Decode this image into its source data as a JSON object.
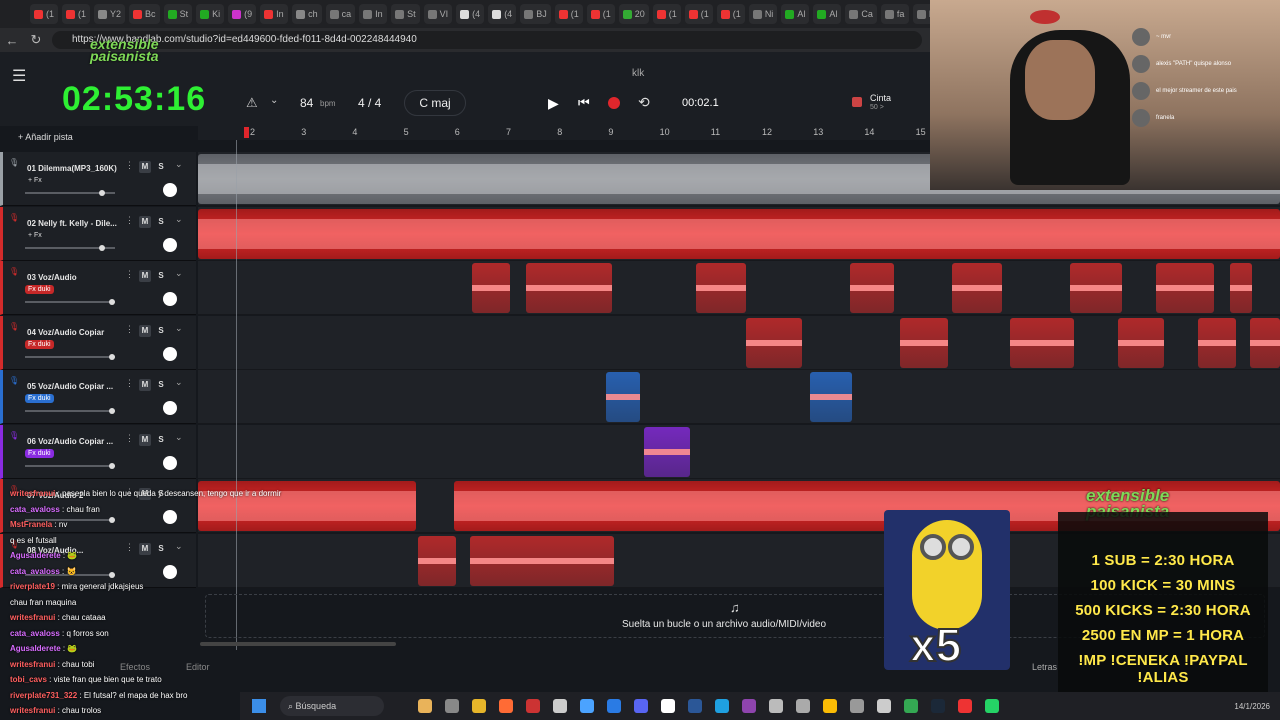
{
  "browser": {
    "tabs": [
      "(1",
      "(1",
      "Y2",
      "Bc",
      "St",
      "Ki",
      "(9",
      "In",
      "ch",
      "ca",
      "In",
      "St",
      "VI",
      "(4",
      "(4",
      "BJ",
      "(1",
      "(1",
      "20",
      "(1",
      "(1",
      "(1",
      "Ni",
      "Al",
      "Al",
      "Ca",
      "fa",
      "Di"
    ],
    "url": "https://www.bandlab.com/studio?id=ed449600-fded-f011-8d4d-002248444940"
  },
  "overlay": {
    "timer": "02:53:16",
    "logo_line1": "extensible",
    "logo_line2": "paisanista"
  },
  "daw": {
    "project_title": "klk",
    "bpm": "84",
    "bpm_unit": "bpm",
    "time_signature": "4 / 4",
    "key": "C maj",
    "time_display": "00:02.1",
    "cinta_label": "Cinta",
    "cinta_sub": "50 >",
    "add_track": "+ Añadir pista",
    "ruler_marks": [
      "2",
      "3",
      "4",
      "5",
      "6",
      "7",
      "8",
      "9",
      "10",
      "11",
      "12",
      "13",
      "14",
      "15"
    ],
    "drop_hint": "Suelta un bucle o un archivo audio/MIDI/video",
    "bottom_tabs": [
      "Efectos",
      "Editor"
    ],
    "letras": "Letras",
    "tracks": [
      {
        "number": "01",
        "name": "Dilemma(MP3_160K)",
        "fx": "+ Fx",
        "fx_color": "none",
        "color": "#9aa0a6",
        "mute": "M",
        "solo": "S"
      },
      {
        "number": "02",
        "name": "Nelly ft. Kelly - Dile...",
        "fx": "+ Fx",
        "fx_color": "none",
        "color": "#d32b2b",
        "mute": "M",
        "solo": "S"
      },
      {
        "number": "03",
        "name": "Voz/Audio",
        "fx": "Fx duki",
        "fx_color": "#c62828",
        "color": "#d32b2b",
        "mute": "M",
        "solo": "S"
      },
      {
        "number": "04",
        "name": "Voz/Audio Copiar",
        "fx": "Fx duki",
        "fx_color": "#c62828",
        "color": "#d32b2b",
        "mute": "M",
        "solo": "S"
      },
      {
        "number": "05",
        "name": "Voz/Audio Copiar ...",
        "fx": "Fx duki",
        "fx_color": "#2a6fd1",
        "color": "#2a6fd1",
        "mute": "M",
        "solo": "S"
      },
      {
        "number": "06",
        "name": "Voz/Audio Copiar ...",
        "fx": "Fx duki",
        "fx_color": "#8a2be2",
        "color": "#8a2be2",
        "mute": "M",
        "solo": "S"
      },
      {
        "number": "07",
        "name": "Voz/Audio 2",
        "fx": "",
        "fx_color": "none",
        "color": "#d32b2b",
        "mute": "M",
        "solo": "S"
      },
      {
        "number": "08",
        "name": "Voz/Audio...",
        "fx": "",
        "fx_color": "none",
        "color": "#d32b2b",
        "mute": "M",
        "solo": "S"
      }
    ]
  },
  "chat": [
    {
      "user": "writesfranui",
      "text": ": pasenla bien lo que queda y descansen, tengo que ir a dormir"
    },
    {
      "user": "cata_avaloss",
      "text": ": chau fran"
    },
    {
      "user": "MstFranela",
      "text": ": nv"
    },
    {
      "user": "",
      "text": "q es el futsall"
    },
    {
      "user": "Agusalderete",
      "text": ": 🐸"
    },
    {
      "user": "cata_avaloss",
      "text": ": 😺"
    },
    {
      "user": "riverplate19",
      "text": ": mira general jdkajsjeus"
    },
    {
      "user": "",
      "text": "chau fran maquina"
    },
    {
      "user": "writesfranui",
      "text": ": chau cataaa"
    },
    {
      "user": "cata_avaloss",
      "text": ": q forros son"
    },
    {
      "user": "Agusalderete",
      "text": ": 🐸"
    },
    {
      "user": "writesfranui",
      "text": ": chau tobi"
    },
    {
      "user": "tobi_cavs",
      "text": ": viste fran que bien que te trato"
    },
    {
      "user": "riverplate731_322",
      "text": ": El futsal? el mapa de hax bro"
    },
    {
      "user": "writesfranui",
      "text": ": chau trolos"
    }
  ],
  "webcam_chat": [
    {
      "user": "~ mvr",
      "text": ""
    },
    {
      "user": "alexis \"PATH\" quispe alonso",
      "text": ""
    },
    {
      "user": "",
      "text": "el mejor streamer de este pais"
    },
    {
      "user": "",
      "text": "franela"
    }
  ],
  "promo": {
    "lines": [
      "1 SUB = 2:30 HORA",
      "100 KICK = 30 MINS",
      "500 KICKS = 2:30 HORA",
      "2500 EN MP = 1 HORA",
      "!MP !CENEKA !PAYPAL !ALIAS"
    ]
  },
  "sticker_text": "x5",
  "taskbar": {
    "search": "Búsqueda",
    "date": "14/1/2026"
  }
}
